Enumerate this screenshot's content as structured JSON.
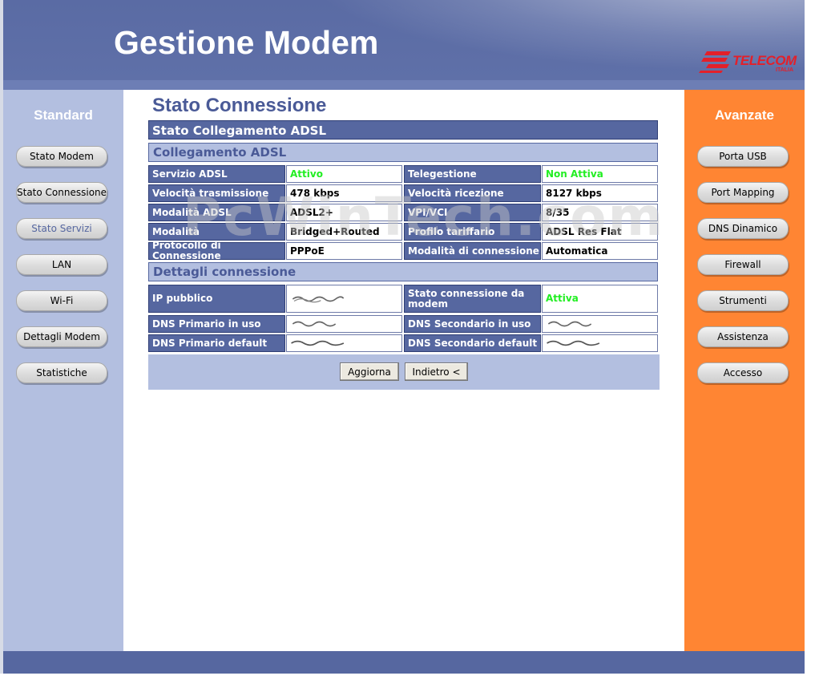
{
  "header": {
    "title": "Gestione Modem",
    "logo_brand": "TELECOM",
    "logo_sub": "ITALIA"
  },
  "left_panel": {
    "title": "Standard",
    "items": [
      {
        "label": "Stato Modem"
      },
      {
        "label": "Stato Connessione"
      },
      {
        "label": "Stato Servizi"
      },
      {
        "label": "LAN"
      },
      {
        "label": "Wi-Fi"
      },
      {
        "label": "Dettagli Modem"
      },
      {
        "label": "Statistiche"
      }
    ]
  },
  "right_panel": {
    "title": "Avanzate",
    "items": [
      {
        "label": "Porta USB"
      },
      {
        "label": "Port Mapping"
      },
      {
        "label": "DNS Dinamico"
      },
      {
        "label": "Firewall"
      },
      {
        "label": "Strumenti"
      },
      {
        "label": "Assistenza"
      },
      {
        "label": "Accesso"
      }
    ]
  },
  "main": {
    "heading": "Stato Connessione",
    "section_title": "Stato Collegamento ADSL",
    "subsection_adsl": "Collegamento ADSL",
    "subsection_details": "Dettagli connessione",
    "adsl_rows": [
      {
        "l1": "Servizio ADSL",
        "v1": "Attivo",
        "l2": "Telegestione",
        "v2": "Non Attiva"
      },
      {
        "l1": "Velocità trasmissione",
        "v1": "478 kbps",
        "l2": "Velocità ricezione",
        "v2": "8127 kbps"
      },
      {
        "l1": "Modalità ADSL",
        "v1": "ADSL2+",
        "l2": "VPI/VCI",
        "v2": "8/35"
      },
      {
        "l1": "Modalità",
        "v1": "Bridged+Routed",
        "l2": "Profilo tariffario",
        "v2": "ADSL Res Flat"
      },
      {
        "l1": "Protocollo di Connessione",
        "v1": "PPPoE",
        "l2": "Modalità di connessione",
        "v2": "Automatica"
      }
    ],
    "detail_rows": [
      {
        "l1": "IP pubblico",
        "l2": "Stato connessione da modem",
        "v2": "Attiva"
      },
      {
        "l1": "DNS Primario in uso",
        "l2": "DNS Secondario in uso"
      },
      {
        "l1": "DNS Primario default",
        "l2": "DNS Secondario default"
      }
    ],
    "buttons": {
      "refresh": "Aggiorna",
      "back": "Indietro <"
    }
  },
  "watermark": "PcWinTech.com",
  "colors": {
    "header_blue": "#5667a0",
    "left_panel": "#b3bfe0",
    "right_panel": "#ff8533",
    "status_green": "#22ee22"
  }
}
